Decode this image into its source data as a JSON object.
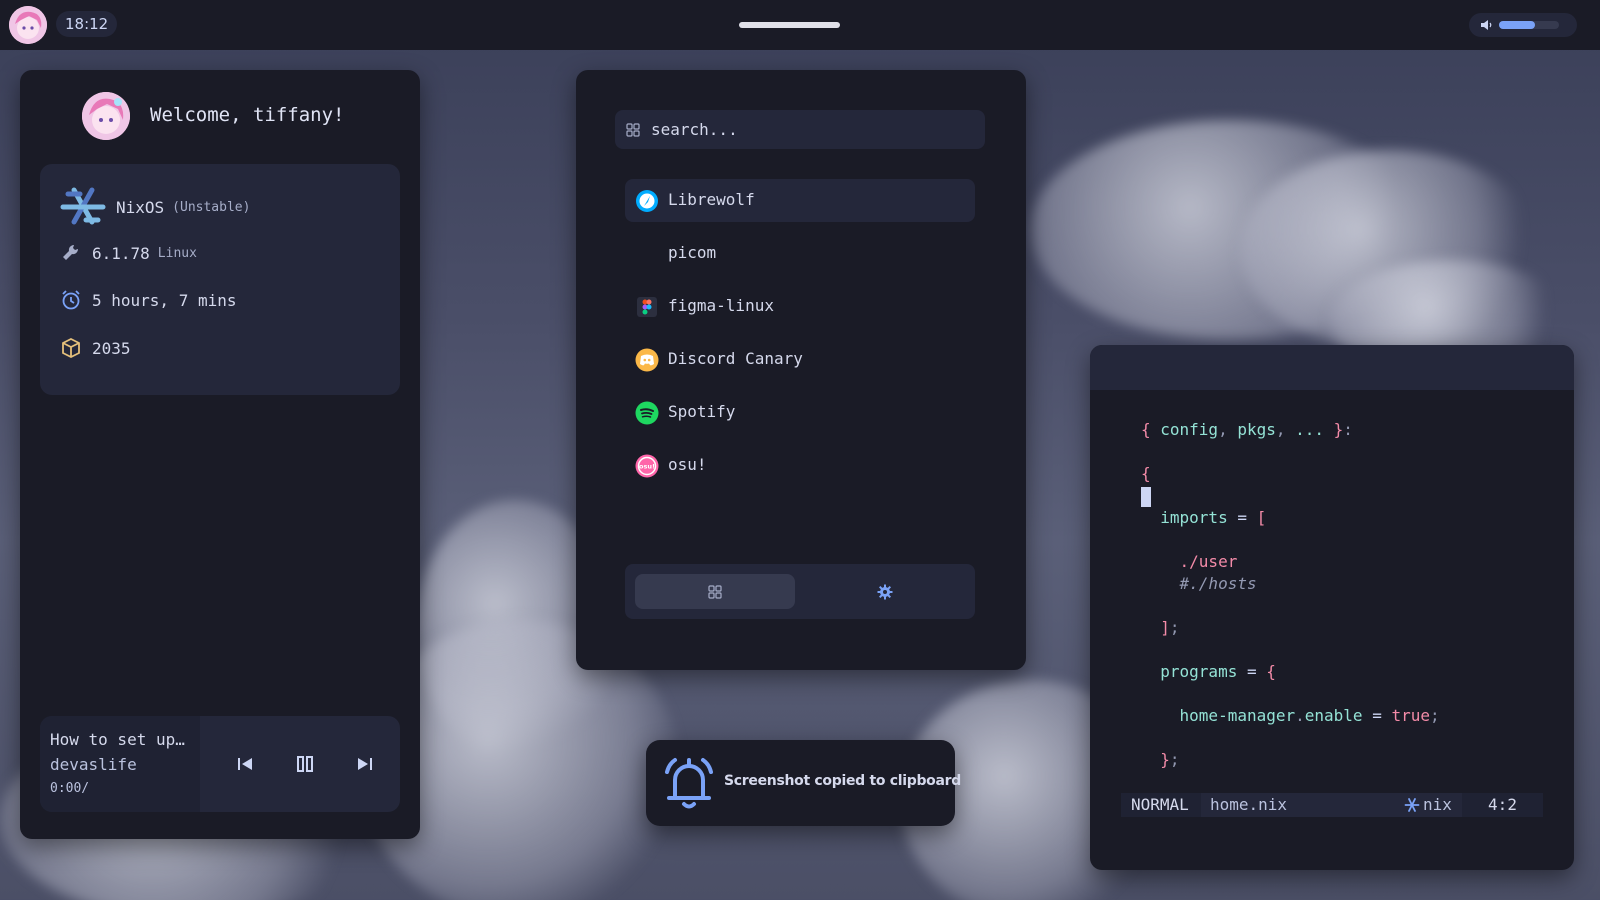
{
  "topbar": {
    "time": "18:12",
    "volume_level": 0.6
  },
  "welcome": {
    "text": "Welcome, tiffany!"
  },
  "sysinfo": {
    "os_name": "NixOS",
    "os_channel": "(Unstable)",
    "kernel": "6.1.78",
    "kernel_label": "Linux",
    "uptime": "5 hours, 7 mins",
    "packages": "2035"
  },
  "music": {
    "title": "How to set up…",
    "artist": "devaslife",
    "time": "0:00/"
  },
  "launcher": {
    "search_placeholder": "search...",
    "apps": [
      {
        "label": "Librewolf",
        "icon": "librewolf-icon",
        "selected": true
      },
      {
        "label": "picom",
        "icon": "none"
      },
      {
        "label": "figma-linux",
        "icon": "figma-icon"
      },
      {
        "label": "Discord Canary",
        "icon": "discord-icon"
      },
      {
        "label": "Spotify",
        "icon": "spotify-icon"
      },
      {
        "label": "osu!",
        "icon": "osu-icon"
      }
    ]
  },
  "notification": {
    "text": "Screenshot copied to clipboard"
  },
  "editor": {
    "lines": [
      "{ config, pkgs, ... }:",
      "{",
      "imports = [",
      "./user",
      "#./hosts",
      "];",
      "programs = {",
      "home-manager.enable = true;",
      "};"
    ],
    "status": {
      "mode": "NORMAL",
      "file": "home.nix",
      "filetype": "nix",
      "position": "4:2"
    }
  },
  "colors": {
    "accent": "#7aa2f7",
    "panel": "#1a1b26",
    "panel_inner": "#24273a",
    "pink": "#f38ba8",
    "teal": "#94e2d5"
  }
}
